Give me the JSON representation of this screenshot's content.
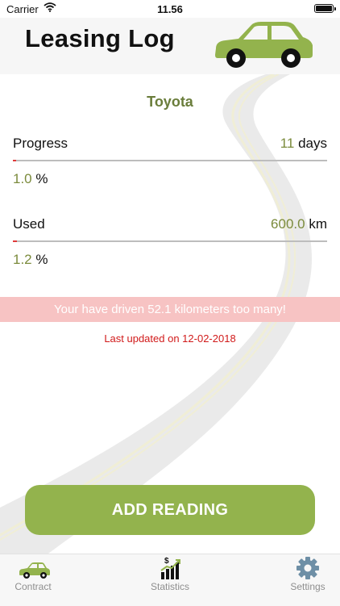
{
  "status_bar": {
    "carrier": "Carrier",
    "time": "11.56",
    "icons": [
      "wifi-icon",
      "battery-icon"
    ]
  },
  "header": {
    "title": "Leasing Log",
    "car_icon": "car-icon",
    "car_color": "#93b34d"
  },
  "contract": {
    "name": "Toyota"
  },
  "progress": {
    "label": "Progress",
    "value": "11",
    "unit": "days",
    "percent_value": "1.0",
    "percent_unit": "%",
    "fill_fraction": 0.01
  },
  "used": {
    "label": "Used",
    "value": "600.0",
    "unit": "km",
    "percent_value": "1.2",
    "percent_unit": "%",
    "fill_fraction": 0.012
  },
  "warning": {
    "text": "Your have driven 52.1 kilometers too many!"
  },
  "last_updated": {
    "text": "Last updated on 12-02-2018"
  },
  "actions": {
    "add_reading_label": "ADD READING"
  },
  "tabs": [
    {
      "label": "Contract",
      "icon": "car-icon"
    },
    {
      "label": "Statistics",
      "icon": "stats-chart-icon"
    },
    {
      "label": "Settings",
      "icon": "gear-icon"
    }
  ],
  "colors": {
    "accent": "#93b34d",
    "value_text": "#7b8b3c",
    "warning_bg": "#f7c3c3",
    "warning_text_red": "#d11a1a",
    "progress_fill": "#e03a3a"
  }
}
